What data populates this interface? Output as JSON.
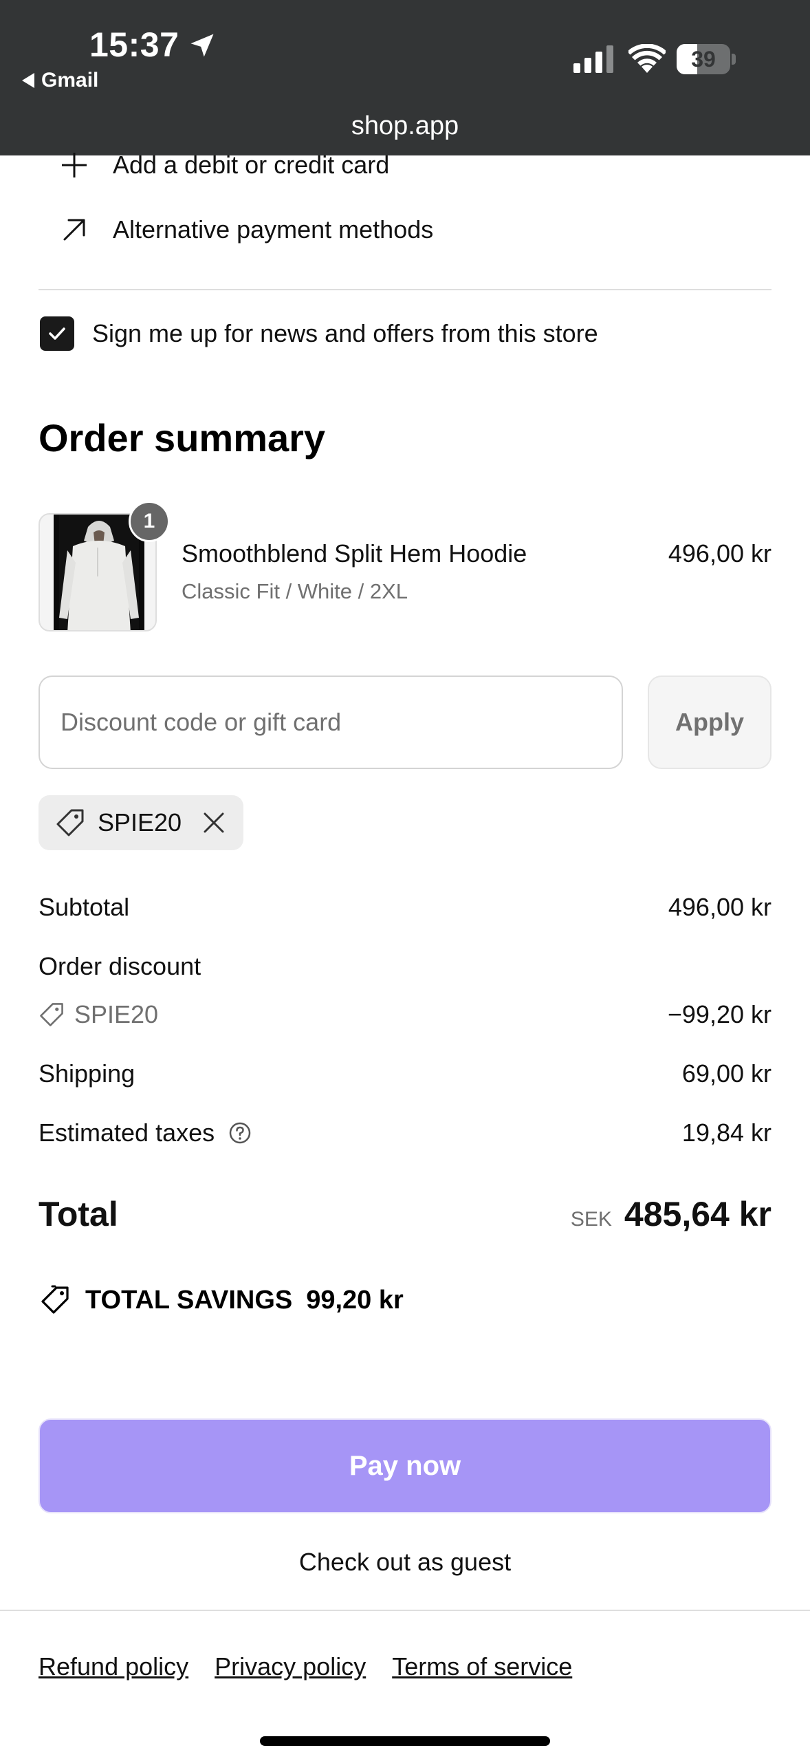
{
  "status_bar": {
    "time": "15:37",
    "back_app": "Gmail",
    "battery": "39",
    "battery_level": 0.39,
    "url": "shop.app"
  },
  "payment": {
    "add_card": "Add a debit or credit card",
    "alternative": "Alternative payment methods"
  },
  "newsletter": {
    "label": "Sign me up for news and offers from this store",
    "checked": true
  },
  "order_summary": {
    "title": "Order summary",
    "item": {
      "quantity": "1",
      "name": "Smoothblend Split Hem Hoodie",
      "variant": "Classic Fit / White / 2XL",
      "price": "496,00 kr"
    },
    "discount": {
      "placeholder": "Discount code or gift card",
      "apply_label": "Apply",
      "applied_code": "SPIE20"
    },
    "lines": {
      "subtotal_label": "Subtotal",
      "subtotal_value": "496,00 kr",
      "order_discount_label": "Order discount",
      "discount_code": "SPIE20",
      "discount_value": "−99,20 kr",
      "shipping_label": "Shipping",
      "shipping_value": "69,00 kr",
      "taxes_label": "Estimated taxes",
      "taxes_value": "19,84 kr"
    },
    "total": {
      "label": "Total",
      "currency": "SEK",
      "value": "485,64 kr"
    },
    "savings": {
      "label": "TOTAL SAVINGS",
      "value": "99,20 kr"
    }
  },
  "actions": {
    "pay_now": "Pay now",
    "guest": "Check out as guest"
  },
  "footer": {
    "refund": "Refund policy",
    "privacy": "Privacy policy",
    "terms": "Terms of service"
  },
  "colors": {
    "status_bar_bg": "#333536",
    "pay_button": "#a695f6",
    "muted_text": "#707070"
  }
}
